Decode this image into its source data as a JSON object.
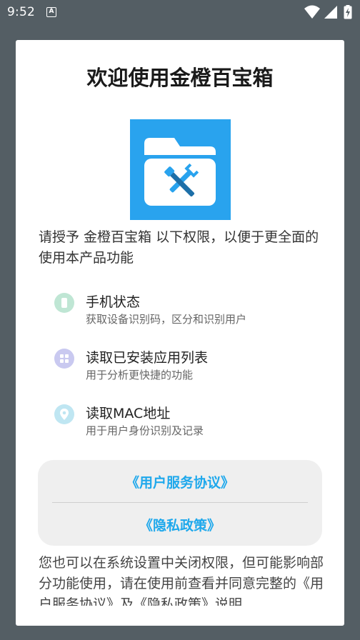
{
  "status_bar": {
    "time": "9:52",
    "notification_icon": "A",
    "icons": [
      "wifi-icon",
      "cellular-signal-icon",
      "battery-icon"
    ]
  },
  "dialog": {
    "title": "欢迎使用金橙百宝箱",
    "intro": "请授予 金橙百宝箱 以下权限，以便于更全面的使用本产品功能",
    "permissions": [
      {
        "title": "手机状态",
        "desc": "获取设备识别码，区分和识别用户",
        "icon": "phone-icon",
        "color": "#bfe6d4"
      },
      {
        "title": "读取已安装应用列表",
        "desc": "用于分析更快捷的功能",
        "icon": "apps-grid-icon",
        "color": "#c9c9f0"
      },
      {
        "title": "读取MAC地址",
        "desc": "用于用户身份识别及记录",
        "icon": "location-pin-icon",
        "color": "#bfe6f2"
      }
    ],
    "links": {
      "service_agreement": "《用户服务协议》",
      "privacy_policy": "《隐私政策》"
    },
    "footer": "您也可以在系统设置中关闭权限，但可能影响部分功能使用，请在使用前查看并同意完整的《用户服务协议》及《隐私政策》说明"
  },
  "colors": {
    "accent": "#1ea8ec",
    "logo_bg": "#29a3ee",
    "backdrop": "#545e64"
  }
}
